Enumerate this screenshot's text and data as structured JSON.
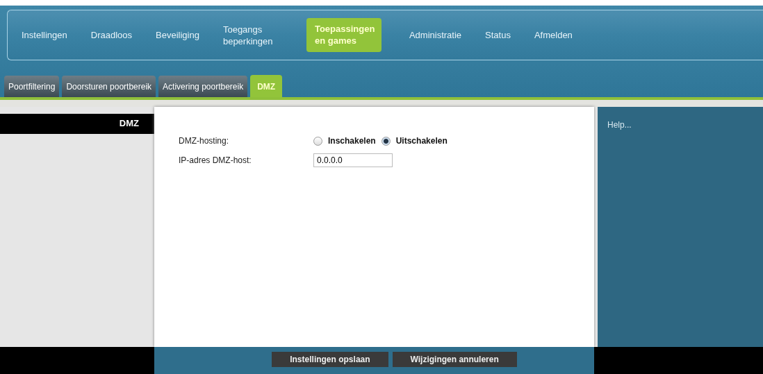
{
  "main_nav": [
    {
      "label": "Instellingen",
      "selected": false
    },
    {
      "label": "Draadloos",
      "selected": false
    },
    {
      "label": "Beveiliging",
      "selected": false
    },
    {
      "label": "Toegangs beperkingen",
      "selected": false
    },
    {
      "label": "Toepassingen en games",
      "selected": true
    },
    {
      "label": "Administratie",
      "selected": false
    },
    {
      "label": "Status",
      "selected": false
    },
    {
      "label": "Afmelden",
      "selected": false
    }
  ],
  "sub_tabs": [
    {
      "label": "Poortfiltering",
      "selected": false
    },
    {
      "label": "Doorsturen poortbereik",
      "selected": false
    },
    {
      "label": "Activering poortbereik",
      "selected": false
    },
    {
      "label": "DMZ",
      "selected": true
    }
  ],
  "sidebar": {
    "title": "DMZ"
  },
  "form": {
    "dmz_hosting": {
      "label": "DMZ-hosting:",
      "options": [
        {
          "label": "Inschakelen",
          "selected": false
        },
        {
          "label": "Uitschakelen",
          "selected": true
        }
      ]
    },
    "ip_address": {
      "label": "IP-adres DMZ-host:",
      "value": "0.0.0.0"
    }
  },
  "help": {
    "title": "Help..."
  },
  "buttons": [
    "Instellingen opslaan",
    "Wijzigingen annuleren"
  ]
}
